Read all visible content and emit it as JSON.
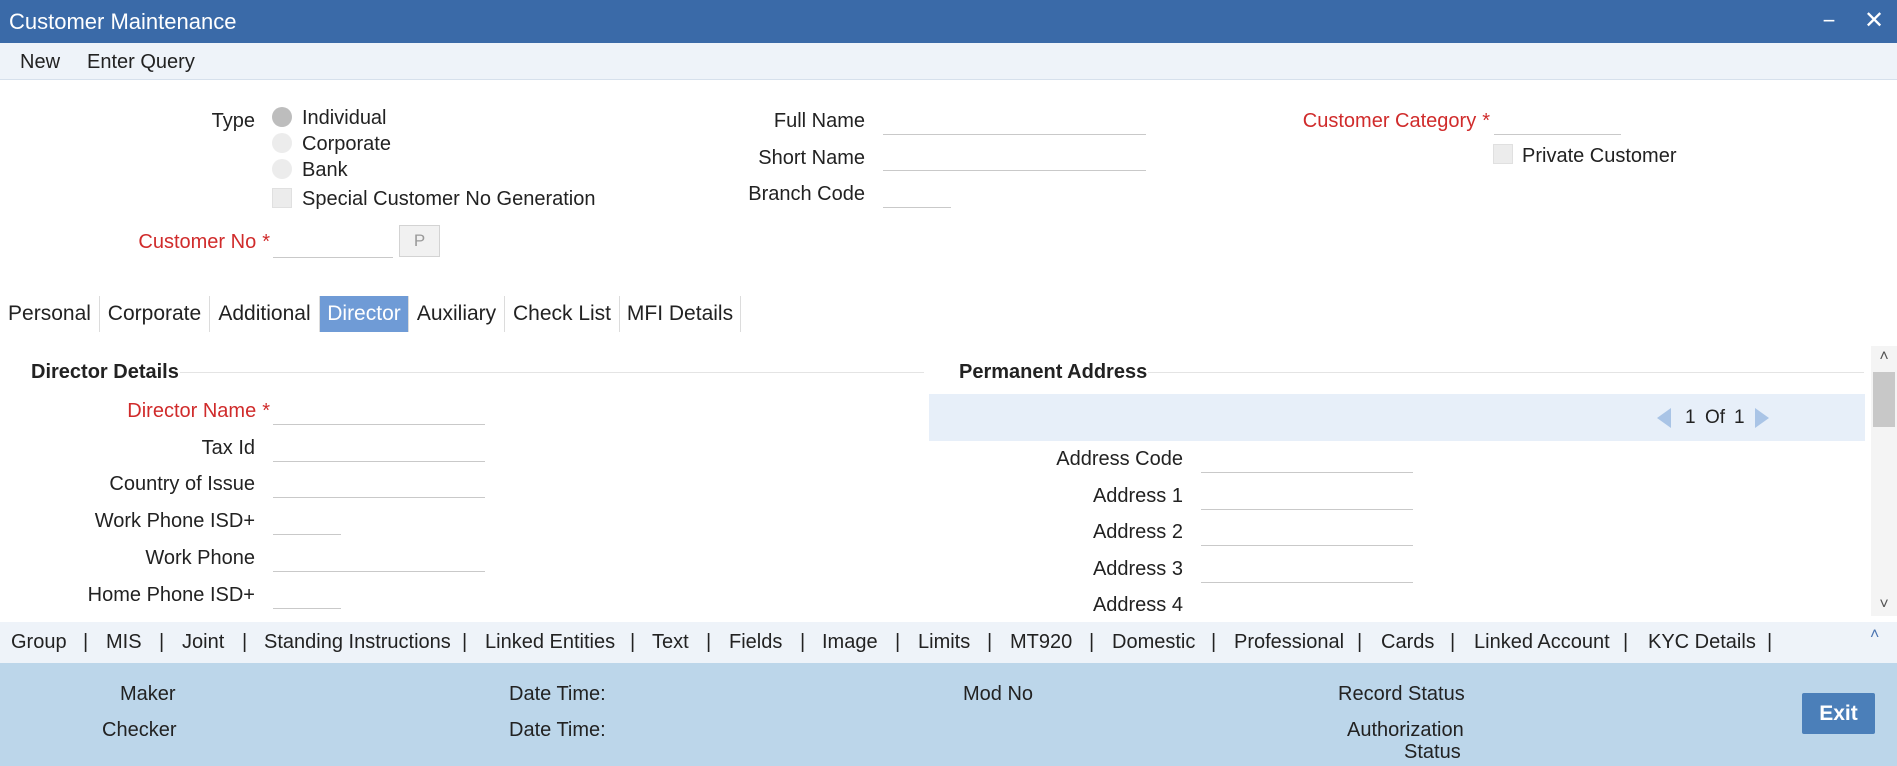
{
  "window": {
    "title": "Customer Maintenance",
    "minimize": "−",
    "close": "✕"
  },
  "menu": {
    "new": "New",
    "enter_query": "Enter Query"
  },
  "header": {
    "type_label": "Type",
    "type_options": [
      "Individual",
      "Corporate",
      "Bank"
    ],
    "special_cust_no_label": "Special Customer No Generation",
    "customer_no_label": "Customer No",
    "customer_no_value": "",
    "p_button": "P",
    "full_name_label": "Full Name",
    "short_name_label": "Short Name",
    "branch_code_label": "Branch Code",
    "customer_category_label": "Customer Category",
    "private_customer_label": "Private Customer",
    "required_mark": "*"
  },
  "tabs": [
    "Personal",
    "Corporate",
    "Additional",
    "Director",
    "Auxiliary",
    "Check List",
    "MFI Details"
  ],
  "active_tab": "Director",
  "director_details": {
    "title": "Director Details",
    "director_name_label": "Director Name",
    "tax_id_label": "Tax Id",
    "country_of_issue_label": "Country of Issue",
    "work_phone_isd_label": "Work Phone ISD+",
    "work_phone_label": "Work Phone",
    "home_phone_isd_label": "Home Phone ISD+"
  },
  "permanent_address": {
    "title": "Permanent Address",
    "page_current": "1",
    "page_of": "Of",
    "page_total": "1",
    "address_code_label": "Address Code",
    "address_1_label": "Address 1",
    "address_2_label": "Address 2",
    "address_3_label": "Address 3",
    "address_4_label": "Address 4"
  },
  "scrollbar": {
    "up": "˄",
    "down": "˅"
  },
  "bottom_tabs": [
    "Group",
    "MIS",
    "Joint",
    "Standing Instructions",
    "Linked Entities",
    "Text",
    "Fields",
    "Image",
    "Limits",
    "MT920",
    "Domestic",
    "Professional",
    "Cards",
    "Linked Account",
    "KYC Details"
  ],
  "bottom_collapse": "˄",
  "footer": {
    "maker": "Maker",
    "checker": "Checker",
    "date_time_1": "Date Time:",
    "date_time_2": "Date Time:",
    "mod_no": "Mod No",
    "record_status": "Record Status",
    "authorization": "Authorization",
    "status": "Status",
    "exit": "Exit"
  },
  "colors": {
    "title_bar": "#3a6aa8",
    "active_tab": "#6f9bd6",
    "required": "#d02b2b",
    "footer": "#bcd6ea",
    "exit_button": "#4b7fb9"
  }
}
